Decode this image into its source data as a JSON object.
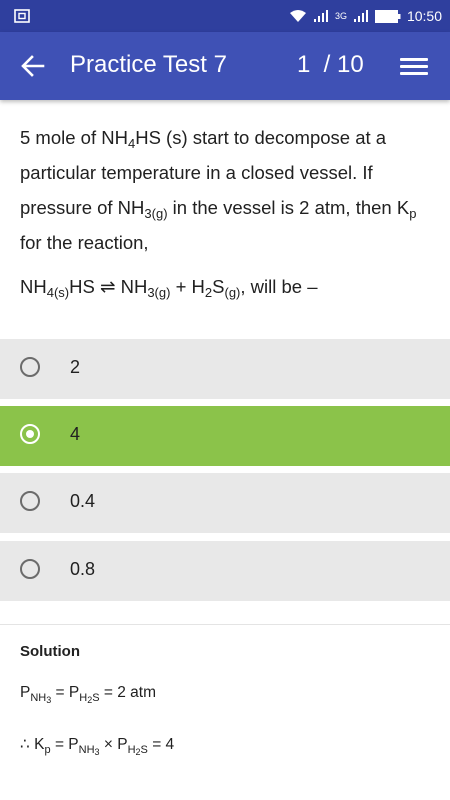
{
  "status_bar": {
    "time": "10:50",
    "network_label": "3G",
    "colors": {
      "background": "#2f3f9e"
    }
  },
  "app_bar": {
    "title": "Practice Test 7",
    "counter": "1  / 10",
    "back_icon": "arrow-left-icon",
    "menu_icon": "menu-icon",
    "colors": {
      "background": "#3f51b5"
    }
  },
  "question": {
    "text_1": "5 mole of NH",
    "sub_1": "4",
    "text_2": "HS (s) start to decompose at a particular temperature in a closed vessel. If pressure of NH",
    "sub_2": "3(g)",
    "text_3": " in the vessel is 2 atm, then K",
    "sub_3": "p",
    "text_4": " for the reaction,",
    "eq_1": "NH",
    "eq_sub_1": "4(s)",
    "eq_2": "HS ⇌ NH",
    "eq_sub_2": "3(g)",
    "eq_3": " + H",
    "eq_sub_3": "2",
    "eq_4": "S",
    "eq_sub_4": "(g)",
    "eq_5": ", will be –"
  },
  "options": [
    {
      "label": "2",
      "selected": false
    },
    {
      "label": "4",
      "selected": true
    },
    {
      "label": "0.4",
      "selected": false
    },
    {
      "label": "0.8",
      "selected": false
    }
  ],
  "colors": {
    "option_bg": "#e8e8e8",
    "option_selected_bg": "#8bc34a"
  },
  "solution": {
    "title": "Solution",
    "l1_p1": "P",
    "l1_s1": "NH",
    "l1_s1b": "3",
    "l1_eq": " = P",
    "l1_s2": "H",
    "l1_s2b": "2",
    "l1_s2c": "S",
    "l1_end": " = 2 atm",
    "l2_therefore": "∴ K",
    "l2_s0": "p",
    "l2_eq": " = P",
    "l2_s1": "NH",
    "l2_s1b": "3",
    "l2_x": " × P",
    "l2_s2": "H",
    "l2_s2b": "2",
    "l2_s2c": "S",
    "l2_end": " = 4"
  }
}
